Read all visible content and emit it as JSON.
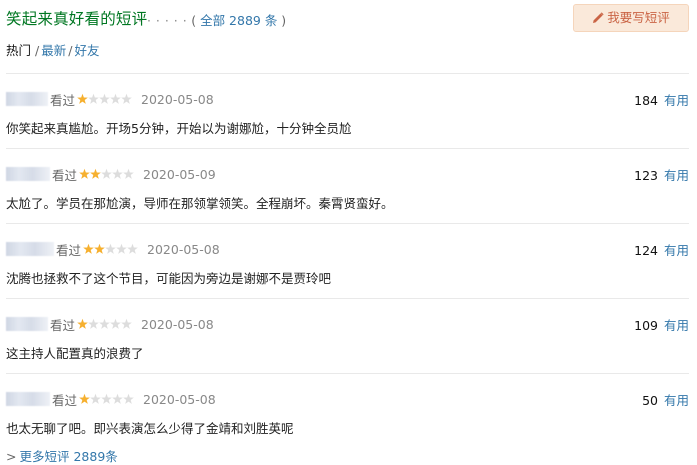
{
  "header": {
    "title": "笑起来真好看的短评",
    "dots": "· · · · · ·",
    "total_open": "( ",
    "total_label": "全部 2889 条",
    "total_close": " )",
    "write_button": "我要写短评"
  },
  "tabs": [
    {
      "label": "热门",
      "active": true
    },
    {
      "label": "最新",
      "active": false
    },
    {
      "label": "好友",
      "active": false
    }
  ],
  "tab_separator": "/",
  "reviews": [
    {
      "seen": "看过",
      "rating": 1,
      "date": "2020-05-08",
      "votes": "184",
      "useful": "有用",
      "content": "你笑起来真尴尬。开场5分钟，开始以为谢娜尬，十分钟全员尬"
    },
    {
      "seen": "看过",
      "rating": 2,
      "date": "2020-05-09",
      "votes": "123",
      "useful": "有用",
      "content": "太尬了。学员在那尬演，导师在那领掌领笑。全程崩坏。秦霄贤蛮好。"
    },
    {
      "seen": "看过",
      "rating": 2,
      "date": "2020-05-08",
      "votes": "124",
      "useful": "有用",
      "content": "沈腾也拯救不了这个节目，可能因为旁边是谢娜不是贾玲吧"
    },
    {
      "seen": "看过",
      "rating": 1,
      "date": "2020-05-08",
      "votes": "109",
      "useful": "有用",
      "content": "这主持人配置真的浪费了"
    },
    {
      "seen": "看过",
      "rating": 1,
      "date": "2020-05-08",
      "votes": "50",
      "useful": "有用",
      "content": "也太无聊了吧。即兴表演怎么少得了金靖和刘胜英呢"
    }
  ],
  "more_link": {
    "arrow": ">",
    "label": "更多短评 2889条"
  },
  "colors": {
    "title_green": "#007722",
    "link_blue": "#3377aa",
    "star_filled": "#f6b02f",
    "star_empty": "#dddddd",
    "button_bg": "#fae9da",
    "button_text": "#ca6445"
  }
}
